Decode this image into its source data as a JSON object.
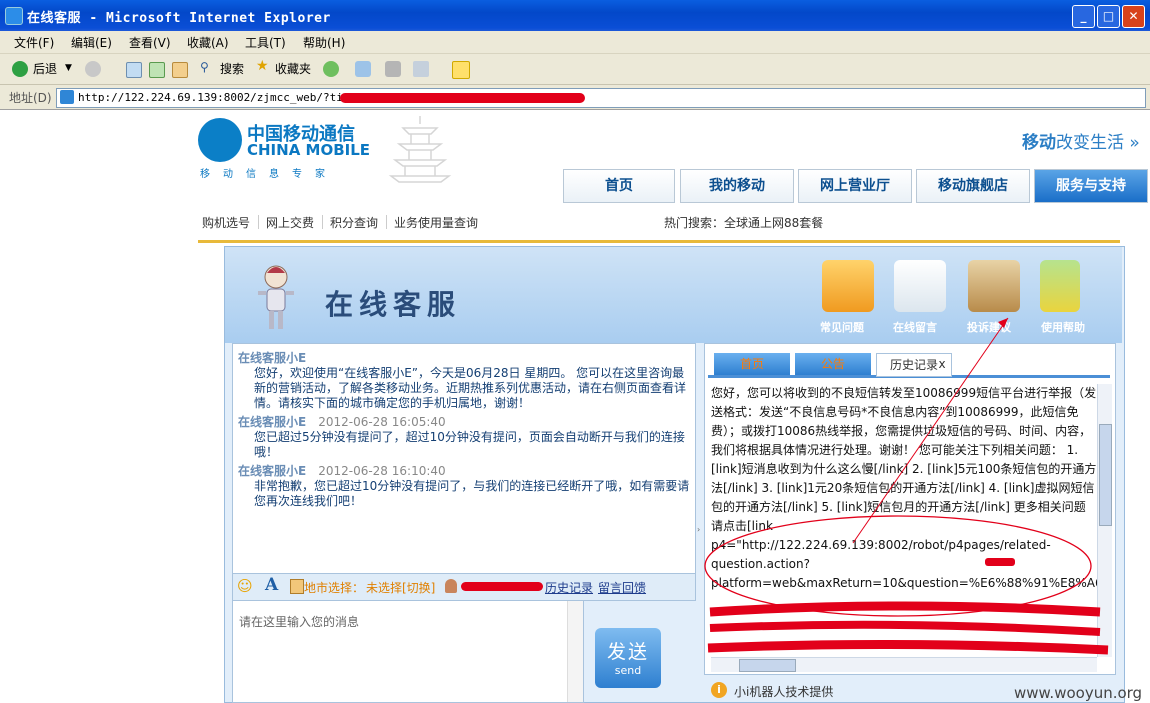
{
  "window": {
    "title": "在线客服 - Microsoft Internet Explorer"
  },
  "menu": [
    "文件(F)",
    "编辑(E)",
    "查看(V)",
    "收藏(A)",
    "工具(T)",
    "帮助(H)"
  ],
  "toolbar": {
    "back": "后退",
    "search": "搜索",
    "favorites": "收藏夹"
  },
  "address": {
    "label": "地址(D)",
    "url": "http://122.224.69.139:8002/zjmcc_web/?ticket"
  },
  "site": {
    "logo_cn": "中国移动通信",
    "logo_en": "CHINA MOBILE",
    "logo_tag": "移动信息专家",
    "slogan_a": "移动",
    "slogan_b": "改变生活 »",
    "nav": [
      "首页",
      "我的移动",
      "网上营业厅",
      "移动旗舰店",
      "服务与支持"
    ],
    "subnav": [
      "购机选号",
      "网上交费",
      "积分查询",
      "业务使用量查询"
    ],
    "hot_search": "热门搜索：全球通上网88套餐"
  },
  "chat": {
    "title": "在线客服",
    "header_icons": [
      "常见问题",
      "在线留言",
      "投诉建议",
      "使用帮助"
    ],
    "messages": [
      {
        "sender": "在线客服小E",
        "time": "",
        "text": "您好，欢迎使用“在线客服小E”，今天是06月28日 星期四。 您可以在这里咨询最新的营销活动，了解各类移动业务。近期热推系列优惠活动，请在右侧页面查看详情。请核实下面的城市确定您的手机归属地，谢谢！"
      },
      {
        "sender": "在线客服小E",
        "time": "2012-06-28 16:05:40",
        "text": "您已超过5分钟没有提问了，超过10分钟没有提问，页面会自动断开与我们的连接哦！"
      },
      {
        "sender": "在线客服小E",
        "time": "2012-06-28 16:10:40",
        "text": "非常抱歉，您已超过10分钟没有提问了，与我们的连接已经断开了哦，如有需要请您再次连线我们吧！"
      }
    ],
    "tools": {
      "city_label": "地市选择：",
      "city_value": "未选择[切换]",
      "history": "历史记录",
      "feedback": "留言回馈"
    },
    "input_placeholder": "请在这里输入您的消息",
    "send_cn": "发送",
    "send_en": "send",
    "right_tabs": [
      "首页",
      "公告",
      "历史记录",
      "x"
    ],
    "right_text": "您好，您可以将收到的不良短信转发至10086999短信平台进行举报（发送格式：发送“不良信息号码*不良信息内容”到10086999，此短信免费）；或拨打10086热线举报，您需提供垃圾短信的号码、时间、内容，我们将根据具体情况进行处理。谢谢！ 您可能关注下列相关问题： 1. [link]短消息收到为什么这么慢[/link] 2. [link]5元100条短信包的开通方法[/link] 3. [link]1元20条短信包的开通方法[/link] 4. [link]虚拟网短信包的开通方法[/link] 5. [link]短信包月的开通方法[/link] 更多相关问题请点击[link p4=\"http://122.224.69.139:8002/robot/p4pages/related-question.action?platform=web&maxReturn=10&question=%E6%88%91%E8%A6%81%E6%8A%95%E8%AF%89%EF%BC%9A%E4%BB%8A%E5%A4%A9%E6%94%B6%E5%88%B0%E5%A4%A7%E9%87%8F%E7%AD%89%E7%9F%AD%E4%BF%A1%E5%B9%BF%E5%91%8A%E7%9F%AD%E4%BF%A1%E6%88%91%E8%A6%81%E6%8A%95%E8%AF%89%E3%80%82\"",
    "provider": "小i机器人技术提供"
  },
  "watermark": "www.wooyun.org",
  "colors": {
    "titlebar": "#0a5ee0",
    "accent_blue": "#0b78c2",
    "annotation_red": "#e2001a"
  }
}
